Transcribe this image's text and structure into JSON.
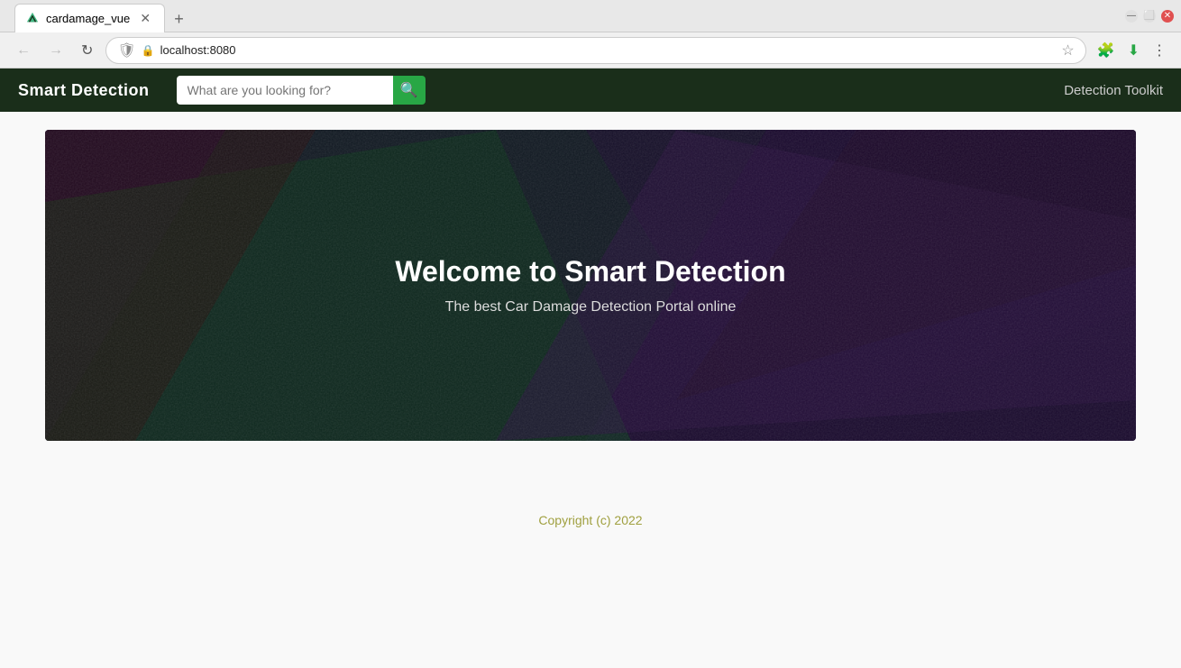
{
  "browser": {
    "tab": {
      "title": "cardamage_vue",
      "favicon_color": "#41b883"
    },
    "address": "localhost:8080",
    "new_tab_label": "+"
  },
  "navbar": {
    "brand": "Smart Detection",
    "search_placeholder": "What are you looking for?",
    "nav_link": "Detection Toolkit"
  },
  "hero": {
    "title": "Welcome to Smart Detection",
    "subtitle": "The best Car Damage Detection Portal online"
  },
  "footer": {
    "copyright": "Copyright (c) 2022"
  }
}
